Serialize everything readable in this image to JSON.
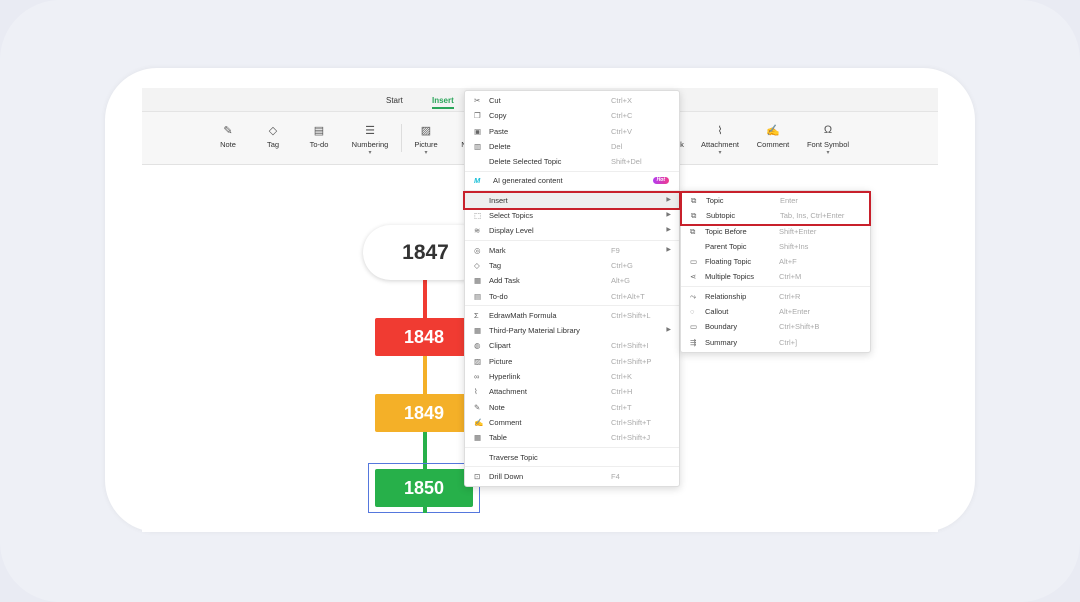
{
  "tabs": [
    {
      "label": "Start"
    },
    {
      "label": "Insert",
      "active": true
    }
  ],
  "toolbar": [
    {
      "label": "Note",
      "icon": "pencil-icon"
    },
    {
      "label": "Tag",
      "icon": "tag-icon"
    },
    {
      "label": "To-do",
      "icon": "todo-icon"
    },
    {
      "label": "Numbering",
      "icon": "list-numbered-icon"
    },
    {
      "label": "Picture",
      "icon": "picture-icon"
    },
    {
      "label": "N",
      "icon": "hidden-icon"
    },
    {
      "label": "k",
      "icon": "hidden-icon"
    },
    {
      "label": "Attachment",
      "icon": "paperclip-icon"
    },
    {
      "label": "Comment",
      "icon": "comment-icon"
    },
    {
      "label": "Font Symbol",
      "icon": "omega-icon"
    }
  ],
  "timeline": {
    "root": "1847",
    "nodes": [
      {
        "label": "1848",
        "color": "#f03b32"
      },
      {
        "label": "1849",
        "color": "#f4b028"
      },
      {
        "label": "1850",
        "color": "#27b04a"
      }
    ]
  },
  "context_menu": {
    "items": [
      {
        "label": "Cut",
        "key": "Ctrl+X",
        "icon": "scissors-icon"
      },
      {
        "label": "Copy",
        "key": "Ctrl+C",
        "icon": "copy-icon"
      },
      {
        "label": "Paste",
        "key": "Ctrl+V",
        "icon": "paste-icon"
      },
      {
        "label": "Delete",
        "key": "Del",
        "icon": "trash-icon"
      },
      {
        "label": "Delete Selected Topic",
        "key": "Shift+Del"
      }
    ],
    "ai": {
      "label": "AI generated content",
      "badge": "Hot"
    },
    "items2": [
      {
        "label": "Insert",
        "submenu": true,
        "highlighted": true
      },
      {
        "label": "Select Topics",
        "submenu": true,
        "icon": "select-icon"
      },
      {
        "label": "Display Level",
        "submenu": true,
        "icon": "layers-icon"
      }
    ],
    "items3": [
      {
        "label": "Mark",
        "key": "F9",
        "submenu": true,
        "icon": "mark-icon"
      },
      {
        "label": "Tag",
        "key": "Ctrl+G",
        "icon": "tag-icon"
      },
      {
        "label": "Add Task",
        "key": "Alt+G",
        "icon": "task-icon"
      },
      {
        "label": "To-do",
        "key": "Ctrl+Alt+T",
        "icon": "todo-icon"
      }
    ],
    "items4": [
      {
        "label": "EdrawMath Formula",
        "key": "Ctrl+Shift+L",
        "icon": "sigma-icon"
      },
      {
        "label": "Third-Party Material Library",
        "submenu": true,
        "icon": "grid-icon"
      },
      {
        "label": "Clipart",
        "key": "Ctrl+Shift+I",
        "icon": "clipart-icon"
      },
      {
        "label": "Picture",
        "key": "Ctrl+Shift+P",
        "icon": "picture-icon"
      },
      {
        "label": "Hyperlink",
        "key": "Ctrl+K",
        "icon": "link-icon"
      },
      {
        "label": "Attachment",
        "key": "Ctrl+H",
        "icon": "paperclip-icon"
      },
      {
        "label": "Note",
        "key": "Ctrl+T",
        "icon": "pencil-icon"
      },
      {
        "label": "Comment",
        "key": "Ctrl+Shift+T",
        "icon": "comment-icon"
      },
      {
        "label": "Table",
        "key": "Ctrl+Shift+J",
        "icon": "table-icon"
      }
    ],
    "items5": [
      {
        "label": "Traverse Topic"
      }
    ],
    "items6": [
      {
        "label": "Drill Down",
        "key": "F4",
        "icon": "drill-down-icon"
      }
    ]
  },
  "submenu": {
    "items": [
      {
        "label": "Topic",
        "key": "Enter",
        "icon": "topic-icon"
      },
      {
        "label": "Subtopic",
        "key": "Tab, Ins, Ctrl+Enter",
        "icon": "subtopic-icon"
      },
      {
        "label": "Topic Before",
        "key": "Shift+Enter",
        "icon": "topic-before-icon"
      },
      {
        "label": "Parent Topic",
        "key": "Shift+Ins"
      },
      {
        "label": "Floating Topic",
        "key": "Alt+F",
        "icon": "floating-icon"
      },
      {
        "label": "Multiple Topics",
        "key": "Ctrl+M",
        "icon": "multiple-icon"
      }
    ],
    "items2": [
      {
        "label": "Relationship",
        "key": "Ctrl+R",
        "icon": "relationship-icon"
      },
      {
        "label": "Callout",
        "key": "Alt+Enter",
        "icon": "callout-icon"
      },
      {
        "label": "Boundary",
        "key": "Ctrl+Shift+B",
        "icon": "boundary-icon"
      },
      {
        "label": "Summary",
        "key": "Ctrl+]",
        "icon": "summary-icon"
      }
    ]
  },
  "colors": {
    "accent": "#2aa55a",
    "highlight": "#c8202b",
    "selection": "#5577dd"
  }
}
